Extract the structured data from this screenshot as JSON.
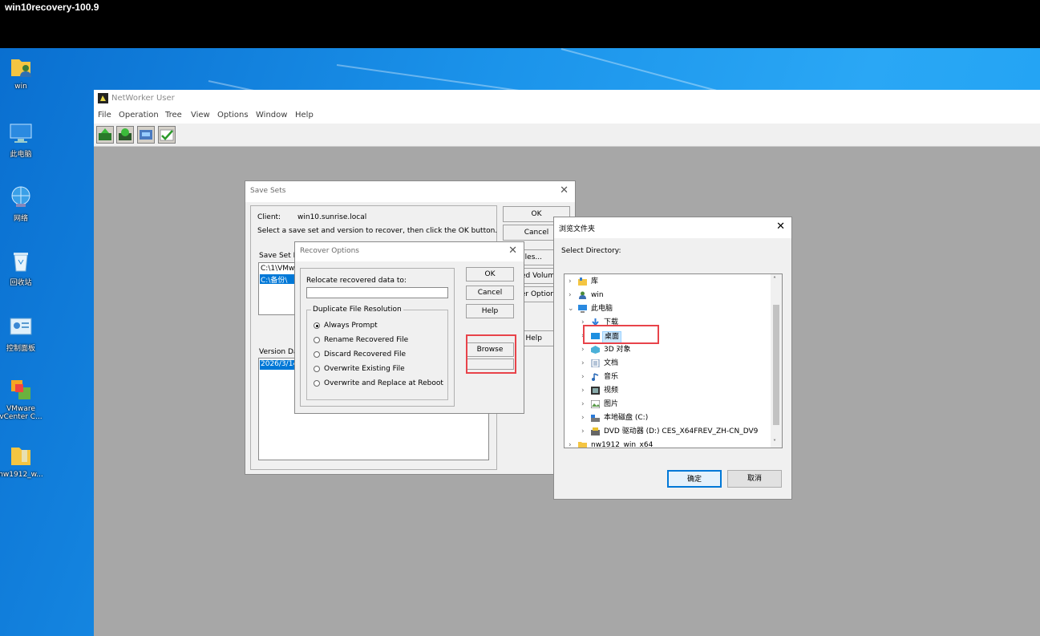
{
  "top_bar": {
    "title": "win10recovery-100.9"
  },
  "desktop_icons": [
    {
      "label": "win",
      "icon": "user-folder-icon"
    },
    {
      "label": "此电脑",
      "icon": "computer-icon"
    },
    {
      "label": "网络",
      "icon": "network-icon"
    },
    {
      "label": "回收站",
      "icon": "recycle-bin-icon"
    },
    {
      "label": "控制面板",
      "icon": "control-panel-icon"
    },
    {
      "label": "VMware",
      "label2": "vCenter C...",
      "icon": "vmware-icon"
    },
    {
      "label": "nw1912_w...",
      "icon": "folder-icon"
    }
  ],
  "networker": {
    "title": "NetWorker User",
    "menu": [
      "File",
      "Operation",
      "Tree",
      "View",
      "Options",
      "Window",
      "Help"
    ],
    "toolbar": [
      "recover-icon",
      "save-icon",
      "verify-icon",
      "check-icon"
    ]
  },
  "save_sets": {
    "title": "Save Sets",
    "client_label": "Client:",
    "client_value": "win10.sunrise.local",
    "instruction": "Select a save set and version to recover, then click the OK button.",
    "save_set_label": "Save Set Na",
    "save_set_items": [
      "C:\\1\\VMw",
      "C:\\备份\\"
    ],
    "version_label": "Version Dat",
    "version_items": [
      "2026/3/14"
    ],
    "buttons": {
      "ok": "OK",
      "cancel": "Cancel",
      "files": "Files...",
      "volumes": "ed Volum",
      "options": "ver Option",
      "help": "Help"
    }
  },
  "recover_options": {
    "title": "Recover Options",
    "relocate_label": "Relocate recovered data to:",
    "relocate_value": "",
    "group_title": "Duplicate File Resolution",
    "options": [
      "Always Prompt",
      "Rename Recovered File",
      "Discard Recovered File",
      "Overwrite Existing File",
      "Overwrite and Replace at Reboot"
    ],
    "selected": "Always Prompt",
    "buttons": {
      "ok": "OK",
      "cancel": "Cancel",
      "help": "Help",
      "browse": "Browse"
    }
  },
  "browse_folder": {
    "title": "浏览文件夹",
    "prompt": "Select Directory:",
    "tree": [
      {
        "label": "库",
        "icon": "library-icon",
        "level": 0,
        "expanded": false
      },
      {
        "label": "win",
        "icon": "user-icon",
        "level": 0,
        "expanded": false
      },
      {
        "label": "此电脑",
        "icon": "computer-icon",
        "level": 0,
        "expanded": true
      },
      {
        "label": "下载",
        "icon": "download-icon",
        "level": 1,
        "expanded": false
      },
      {
        "label": "桌面",
        "icon": "desktop-folder-icon",
        "level": 1,
        "expanded": false,
        "selected": true
      },
      {
        "label": "3D 对象",
        "icon": "3d-objects-icon",
        "level": 1,
        "expanded": false
      },
      {
        "label": "文档",
        "icon": "documents-icon",
        "level": 1,
        "expanded": false
      },
      {
        "label": "音乐",
        "icon": "music-icon",
        "level": 1,
        "expanded": false
      },
      {
        "label": "视频",
        "icon": "video-icon",
        "level": 1,
        "expanded": false
      },
      {
        "label": "图片",
        "icon": "pictures-icon",
        "level": 1,
        "expanded": false
      },
      {
        "label": "本地磁盘 (C:)",
        "icon": "drive-icon",
        "level": 1,
        "expanded": false
      },
      {
        "label": "DVD 驱动器 (D:) CES_X64FREV_ZH-CN_DV9",
        "icon": "dvd-icon",
        "level": 1,
        "expanded": false
      },
      {
        "label": "nw1912_win_x64",
        "icon": "folder-icon",
        "level": 0,
        "expanded": false
      }
    ],
    "buttons": {
      "ok": "确定",
      "cancel": "取消"
    }
  },
  "colors": {
    "highlight": "#0078d7",
    "annotation": "#e8434a",
    "workspace": "#a7a7a7"
  }
}
